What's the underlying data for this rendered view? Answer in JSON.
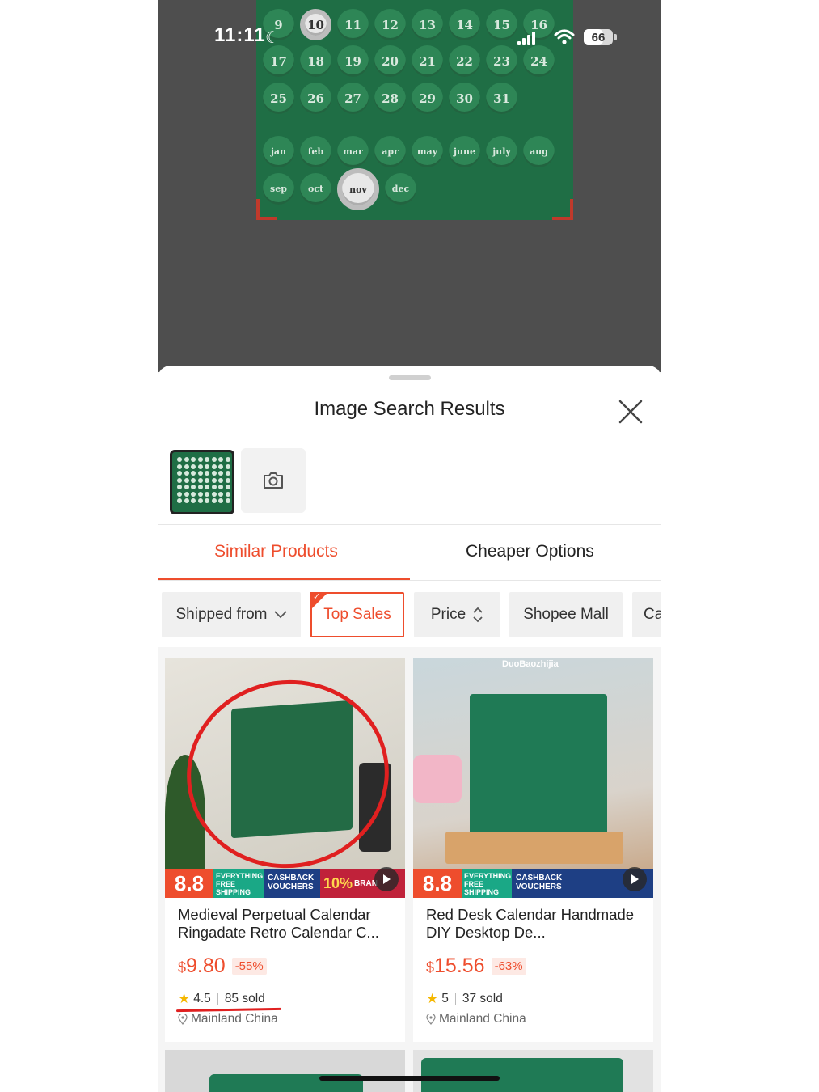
{
  "status_bar": {
    "time": "11:11",
    "battery": "66",
    "battery_level": 0.66
  },
  "query_image": {
    "rows": [
      [
        "9",
        "10",
        "11",
        "12",
        "13",
        "14",
        "15",
        "16"
      ],
      [
        "17",
        "18",
        "19",
        "20",
        "21",
        "22",
        "23",
        "24"
      ],
      [
        "25",
        "26",
        "27",
        "28",
        "29",
        "30",
        "31"
      ],
      [
        "jan",
        "feb",
        "mar",
        "apr",
        "may",
        "june",
        "july",
        "aug"
      ],
      [
        "sep",
        "oct",
        "nov",
        "dec"
      ]
    ]
  },
  "sheet": {
    "title": "Image Search Results"
  },
  "tabs": {
    "similar": "Similar Products",
    "cheaper": "Cheaper Options"
  },
  "filters": {
    "shipped_from": "Shipped from",
    "top_sales": "Top Sales",
    "price": "Price",
    "shopee_mall": "Shopee Mall",
    "more": "Ca"
  },
  "banner": {
    "sale": "8.8",
    "free_shipping_1": "EVERYTHING",
    "free_shipping_2": "FREE",
    "free_shipping_3": "SHIPPING",
    "cashback_1": "CASHBACK",
    "cashback_2": "VOUCHERS",
    "brand": "10%",
    "brand_label": "BRAN"
  },
  "products": [
    {
      "title": "Medieval Perpetual Calendar Ringadate Retro Calendar C...",
      "currency": "$",
      "price": "9.80",
      "discount": "-55%",
      "rating": "4.5",
      "sold": "85 sold",
      "location": "Mainland China"
    },
    {
      "title": "Red Desk Calendar Handmade DIY Desktop De...",
      "currency": "$",
      "price": "15.56",
      "discount": "-63%",
      "rating": "5",
      "sold": "37 sold",
      "location": "Mainland China",
      "watermark": "DuoBaozhijia"
    }
  ],
  "colors": {
    "accent": "#ee4d2d",
    "calendar_green": "#1f6e45"
  }
}
